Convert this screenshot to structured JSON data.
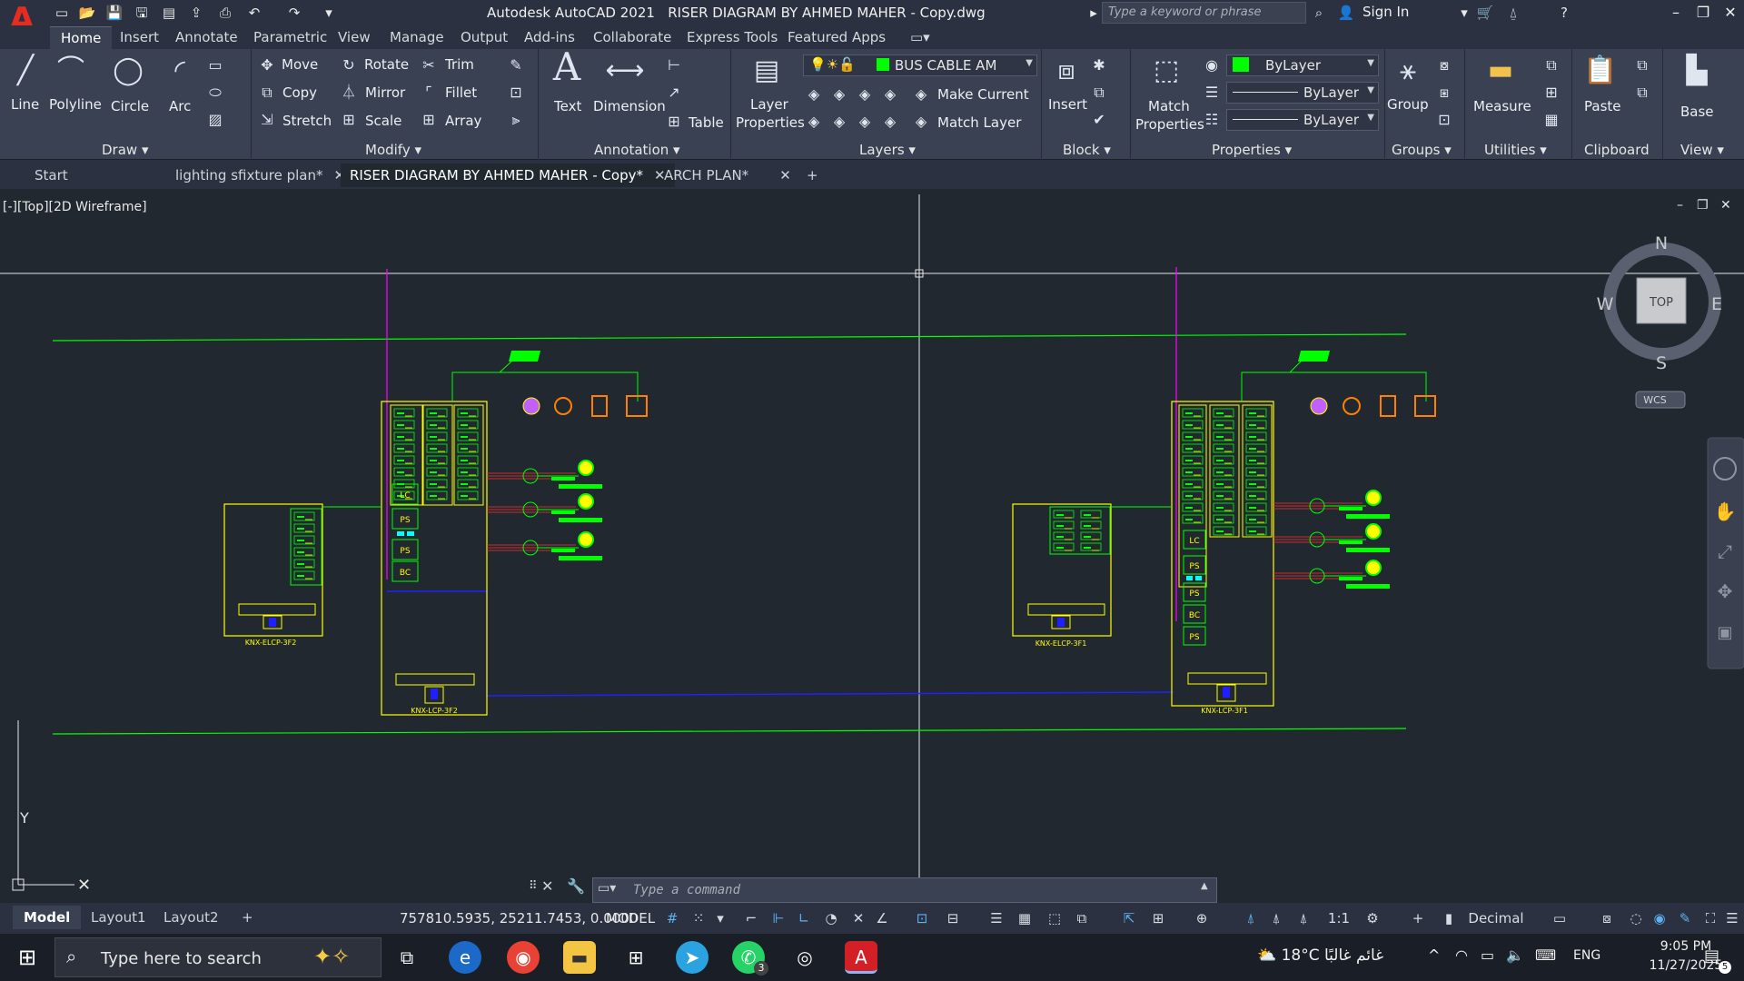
{
  "titlebar": {
    "app_name": "Autodesk AutoCAD 2021",
    "file_name": "RISER DIAGRAM BY AHMED MAHER - Copy.dwg",
    "search_placeholder": "Type a keyword or phrase",
    "sign_in": "Sign In"
  },
  "ribbon_tabs": [
    "Home",
    "Insert",
    "Annotate",
    "Parametric",
    "View",
    "Manage",
    "Output",
    "Add-ins",
    "Collaborate",
    "Express Tools",
    "Featured Apps"
  ],
  "draw_panel": {
    "title": "Draw",
    "line": "Line",
    "polyline": "Polyline",
    "circle": "Circle",
    "arc": "Arc"
  },
  "modify_panel": {
    "title": "Modify",
    "move": "Move",
    "rotate": "Rotate",
    "trim": "Trim",
    "copy": "Copy",
    "mirror": "Mirror",
    "fillet": "Fillet",
    "stretch": "Stretch",
    "scale": "Scale",
    "array": "Array"
  },
  "annotation_panel": {
    "title": "Annotation",
    "text": "Text",
    "dimension": "Dimension",
    "table": "Table"
  },
  "layers_panel": {
    "title": "Layers",
    "layer_properties_1": "Layer",
    "layer_properties_2": "Properties",
    "current_layer": "BUS CABLE AM",
    "make_current": "Make Current",
    "match_layer": "Match Layer"
  },
  "block_panel": {
    "title": "Block",
    "insert": "Insert"
  },
  "properties_panel": {
    "title": "Properties",
    "match_1": "Match",
    "match_2": "Properties",
    "color": "ByLayer",
    "linetype": "ByLayer",
    "lineweight": "ByLayer"
  },
  "groups_panel": {
    "title": "Groups",
    "group": "Group"
  },
  "utilities_panel": {
    "title": "Utilities",
    "measure": "Measure"
  },
  "clipboard_panel": {
    "title": "Clipboard",
    "paste": "Paste"
  },
  "view_panel": {
    "title": "View",
    "base": "Base"
  },
  "doc_tabs": [
    "Start",
    "lighting sfixture plan*",
    "RISER DIAGRAM BY AHMED MAHER - Copy*",
    "ARCH PLAN*"
  ],
  "viewport": {
    "label": "[-][Top][2D Wireframe]",
    "compass_n": "N",
    "compass_s": "S",
    "compass_e": "E",
    "compass_w": "W",
    "cube_face": "TOP",
    "wcs": "WCS",
    "ucs_y": "Y",
    "panels": {
      "left_small": "KNX-ELCP-3F2",
      "left_big": "KNX-LCP-3F2",
      "right_small": "KNX-ELCP-3F1",
      "right_big": "KNX-LCP-3F1",
      "lc": "LC",
      "ps": "PS",
      "bc": "BC"
    }
  },
  "command_line": {
    "placeholder": "Type a command"
  },
  "status_bar": {
    "layouts": [
      "Model",
      "Layout1",
      "Layout2"
    ],
    "coordinates": "757810.5935, 25211.7453, 0.0000",
    "model": "MODEL",
    "scale": "1:1",
    "units": "Decimal"
  },
  "taskbar": {
    "search_placeholder": "Type here to search",
    "temperature": "18°C",
    "weather": "غائم غالبًا",
    "language": "ENG",
    "time": "9:05 PM",
    "date": "11/27/2025",
    "whatsapp_badge": "3",
    "notification_badge": "5"
  },
  "colors": {
    "canvas": "#212830",
    "wire_green": "#00ff00",
    "panel_yellow": "#ffff00",
    "magenta": "#ff00ff",
    "bus_blue": "#0000ff",
    "cable_red": "#ff3030"
  }
}
